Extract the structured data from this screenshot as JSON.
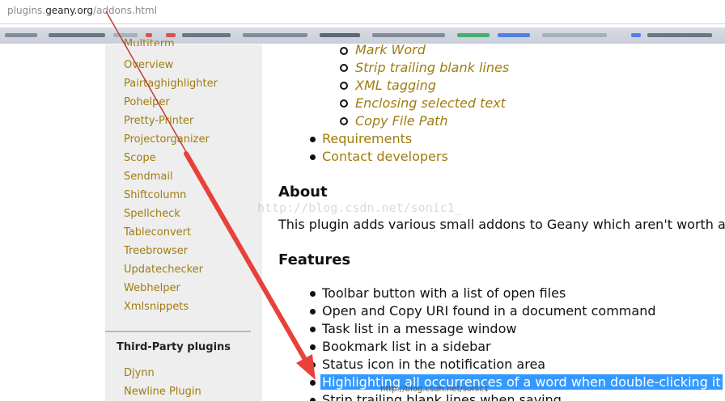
{
  "address_bar": {
    "host_prefix": "plugins.",
    "host": "geany.org",
    "path": "/addons.html"
  },
  "sidebar": {
    "cut_item": "Multiterm",
    "items": [
      "Overview",
      "Pairtaghighlighter",
      "Pohelper",
      "Pretty-Printer",
      "Projectorganizer",
      "Scope",
      "Sendmail",
      "Shiftcolumn",
      "Spellcheck",
      "Tableconvert",
      "Treebrowser",
      "Updatechecker",
      "Webhelper",
      "Xmlsnippets"
    ],
    "third_party_heading": "Third-Party plugins",
    "third_party_items": [
      "Djynn",
      "Newline Plugin"
    ]
  },
  "main": {
    "sub_items": [
      "Mark Word",
      "Strip trailing blank lines",
      "XML tagging",
      "Enclosing selected text",
      "Copy File Path"
    ],
    "top_items": [
      "Requirements",
      "Contact developers"
    ],
    "about_heading": "About",
    "about_text": "This plugin adds various small addons to Geany which aren't worth an ow",
    "features_heading": "Features",
    "features": [
      "Toolbar button with a list of open files",
      "Open and Copy URI found in a document command",
      "Task list in a message window",
      "Bookmark list in a sidebar",
      "Status icon in the notification area",
      "Highlighting all occurrences of a word when double-clicking it",
      "Strip trailing blank lines when saving"
    ],
    "highlighted_feature_index": 5
  },
  "watermarks": {
    "large": "http://blog.csdn.net/sonic1_",
    "small": "http://blog.csdn.net/sonic1"
  },
  "colors": {
    "link": "#a07c0f",
    "selection": "#3399ff",
    "arrow": "#e8413b",
    "sidebar_bg": "#eeeeee"
  }
}
